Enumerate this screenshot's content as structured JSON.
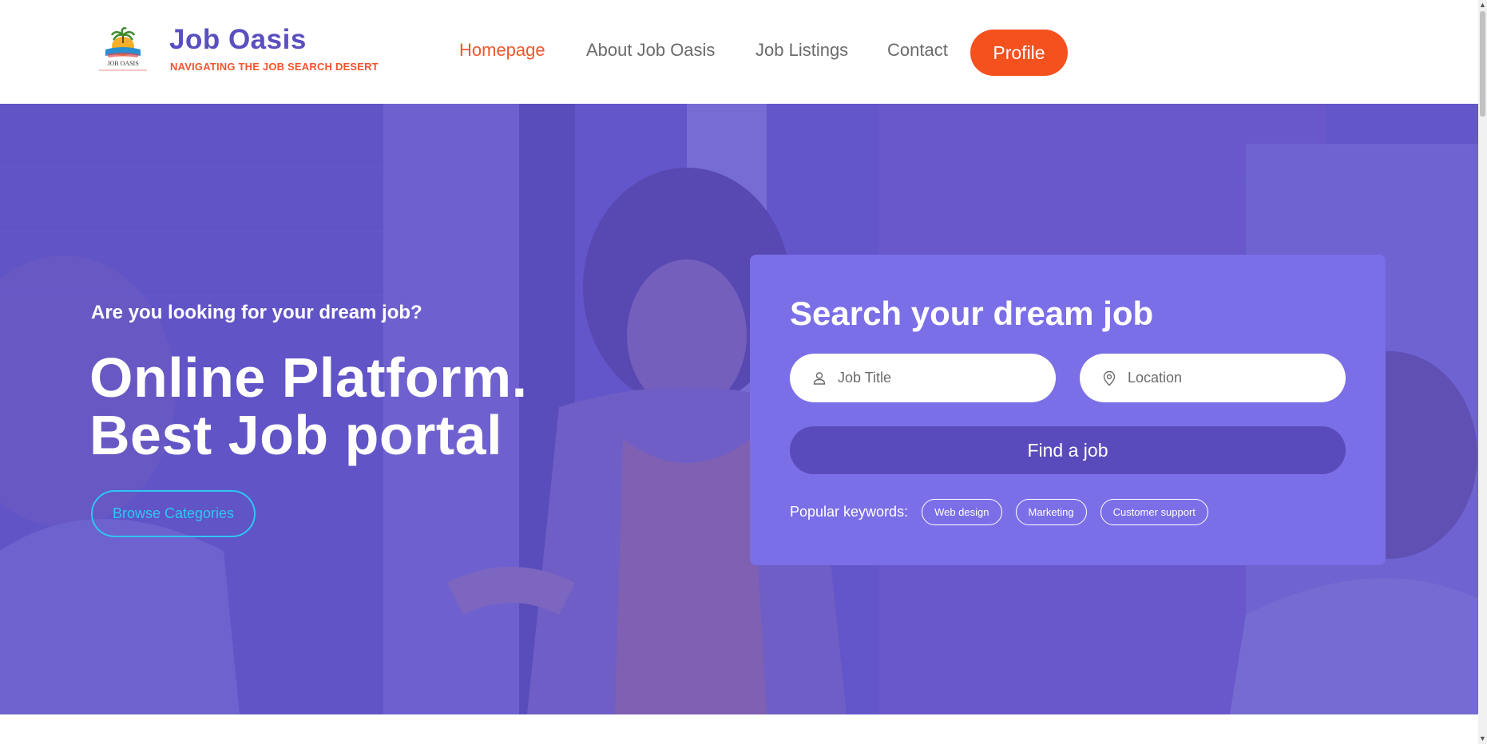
{
  "brand": {
    "title": "Job Oasis",
    "tagline": "NAVIGATING THE JOB SEARCH DESERT",
    "logo_text": "JOB OASIS"
  },
  "nav": {
    "items": [
      {
        "label": "Homepage",
        "active": true
      },
      {
        "label": "About Job Oasis",
        "active": false
      },
      {
        "label": "Job Listings",
        "active": false
      },
      {
        "label": "Contact",
        "active": false
      }
    ],
    "profile_label": "Profile"
  },
  "hero": {
    "eyebrow": "Are you looking for your dream job?",
    "title_line1": "Online Platform.",
    "title_line2": "Best Job portal",
    "browse_label": "Browse Categories"
  },
  "search": {
    "title": "Search your dream job",
    "job_title_placeholder": "Job Title",
    "location_placeholder": "Location",
    "find_label": "Find a job",
    "keywords_label": "Popular keywords:",
    "keywords": [
      "Web design",
      "Marketing",
      "Customer support"
    ]
  },
  "colors": {
    "brand_purple": "#5a4fc0",
    "accent_orange": "#f5511f",
    "card_purple": "#7b6fe8",
    "button_purple": "#5a4bbc",
    "browse_cyan": "#2ec6f2"
  },
  "icons": {
    "job_title_field": "user-icon",
    "location_field": "map-pin-icon"
  }
}
